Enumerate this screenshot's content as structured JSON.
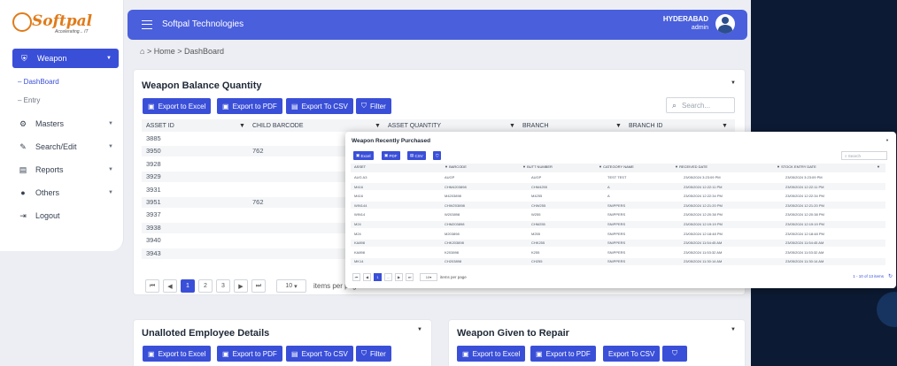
{
  "brand": {
    "logo_main": "Softpal",
    "logo_tagline": "Accelerating... IT"
  },
  "topbar": {
    "title": "Softpal Technologies",
    "location": "HYDERABAD",
    "role": "admin"
  },
  "breadcrumb": "> Home > DashBoard",
  "sidebar": {
    "active": {
      "label": "Weapon",
      "icon": "shield-icon"
    },
    "subitems": [
      "DashBoard",
      "Entry"
    ],
    "items": [
      {
        "label": "Masters",
        "icon": "gear-icon",
        "has_children": true
      },
      {
        "label": "Search/Edit",
        "icon": "edit-icon",
        "has_children": true
      },
      {
        "label": "Reports",
        "icon": "document-icon",
        "has_children": true
      },
      {
        "label": "Others",
        "icon": "info-icon",
        "has_children": true
      },
      {
        "label": "Logout",
        "icon": "logout-icon",
        "has_children": false
      }
    ]
  },
  "toolbar": {
    "excel": "Export to Excel",
    "pdf": "Export to PDF",
    "csv": "Export To CSV",
    "filter": "Filter"
  },
  "balance": {
    "title": "Weapon Balance Quantity",
    "search_placeholder": "Search...",
    "columns": [
      "ASSET ID",
      "CHILD BARCODE",
      "ASSET QUANTITY",
      "BRANCH",
      "BRANCH ID"
    ],
    "rows": [
      [
        "3885",
        ""
      ],
      [
        "3950",
        "762"
      ],
      [
        "3928",
        ""
      ],
      [
        "3929",
        ""
      ],
      [
        "3931",
        ""
      ],
      [
        "3951",
        "762"
      ],
      [
        "3937",
        ""
      ],
      [
        "3938",
        ""
      ],
      [
        "3940",
        ""
      ],
      [
        "3943",
        ""
      ]
    ],
    "pages": [
      "1",
      "2",
      "3"
    ],
    "per_page": "10",
    "per_page_label": "items per page"
  },
  "unalloted": {
    "title": "Unalloted Employee Details"
  },
  "repair": {
    "title": "Weapon Given to Repair",
    "filter_label": ""
  },
  "popup": {
    "title": "Weapon Recently Purchased",
    "buttons": [
      "Excel",
      "PDF",
      "CSV"
    ],
    "search_placeholder": "Search",
    "columns": [
      "ASSET",
      "BARCODE",
      "BUTT NUMBER",
      "CATEGORY NAME",
      "RECEIVED DATE",
      "STOCK ENTRY DATE"
    ],
    "rows": [
      [
        "AUG A3",
        "AUGP",
        "AUGP",
        "TEST TEST",
        "23/05/2024 3:23:09 PM",
        "23/05/2024 3:23:09 PM"
      ],
      [
        "M416",
        "CHM4203898",
        "CHM4255",
        "A",
        "23/05/2024 12:22:11 PM",
        "23/05/2024 12:22:11 PM"
      ],
      [
        "M416",
        "M4203898",
        "M4255",
        "A",
        "23/05/2024 12:22:34 PM",
        "23/05/2024 12:22:34 PM"
      ],
      [
        "WIN144",
        "CHW203898",
        "CHW255",
        "SNIPPERS",
        "23/05/2024 12:21:20 PM",
        "23/05/2024 12:21:20 PM"
      ],
      [
        "WIN14",
        "W203898",
        "W255",
        "SNIPPERS",
        "23/05/2024 12:20:38 PM",
        "23/05/2024 12:20:38 PM"
      ],
      [
        "M24",
        "CHM203898",
        "CHM255",
        "SNIPPERS",
        "23/05/2024 12:19:19 PM",
        "23/05/2024 12:19:19 PM"
      ],
      [
        "M24",
        "M203898",
        "M255",
        "SNIPPERS",
        "23/05/2024 12:18:48 PM",
        "23/05/2024 12:18:48 PM"
      ],
      [
        "KA898",
        "CHK203898",
        "CHK255",
        "SNIPPERS",
        "23/05/2024 11:54:45 AM",
        "23/05/2024 11:54:45 AM"
      ],
      [
        "KA898",
        "K203898",
        "K255",
        "SNIPPERS",
        "23/05/2024 11:53:32 AM",
        "23/05/2024 11:53:32 AM"
      ],
      [
        "MK14",
        "CH203898",
        "CH255",
        "SNIPPERS",
        "23/05/2024 11:30:14 AM",
        "23/05/2024 11:30:14 AM"
      ]
    ],
    "pages": [
      "1",
      "..."
    ],
    "per_page": "10",
    "per_page_label": "items per page",
    "items_label": "1 - 10 of 13 items"
  },
  "colors": {
    "accent": "#3a4fd8",
    "topbar": "#4a5fdc",
    "brand_orange": "#e07b1a",
    "background": "#0c1a33"
  }
}
